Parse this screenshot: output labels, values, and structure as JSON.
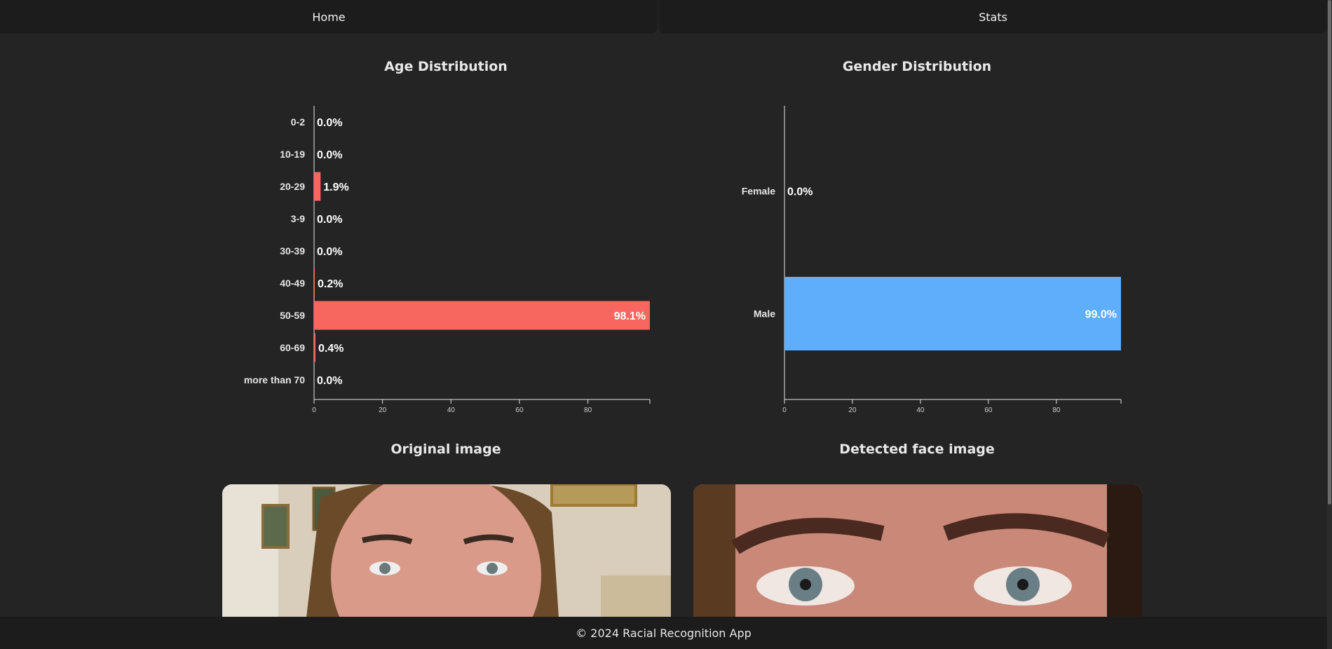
{
  "nav": {
    "home_label": "Home",
    "stats_label": "Stats"
  },
  "age_title": "Age Distribution",
  "gender_title": "Gender Distribution",
  "original_title": "Original image",
  "face_title": "Detected face image",
  "footer": "© 2024 Racial Recognition App",
  "colors": {
    "age_bar": "#f8675f",
    "gender_bar": "#5eaefc",
    "background": "#242424"
  },
  "chart_data": [
    {
      "type": "bar",
      "orientation": "horizontal",
      "title": "Age Distribution",
      "categories": [
        "0-2",
        "10-19",
        "20-29",
        "3-9",
        "30-39",
        "40-49",
        "50-59",
        "60-69",
        "more than 70"
      ],
      "values": [
        0.0,
        0.0,
        1.9,
        0.0,
        0.0,
        0.2,
        98.1,
        0.4,
        0.0
      ],
      "value_labels": [
        "0.0%",
        "0.0%",
        "1.9%",
        "0.0%",
        "0.0%",
        "0.2%",
        "98.1%",
        "0.4%",
        "0.0%"
      ],
      "xlim": [
        0,
        98.1
      ],
      "xticks": [
        0,
        20,
        40,
        60,
        80
      ],
      "xlabel": "",
      "ylabel": ""
    },
    {
      "type": "bar",
      "orientation": "horizontal",
      "title": "Gender Distribution",
      "categories": [
        "Female",
        "Male"
      ],
      "values": [
        0.0,
        99.0
      ],
      "value_labels": [
        "0.0%",
        "99.0%"
      ],
      "xlim": [
        0,
        99.0
      ],
      "xticks": [
        0,
        20,
        40,
        60,
        80
      ],
      "xlabel": "",
      "ylabel": ""
    }
  ]
}
